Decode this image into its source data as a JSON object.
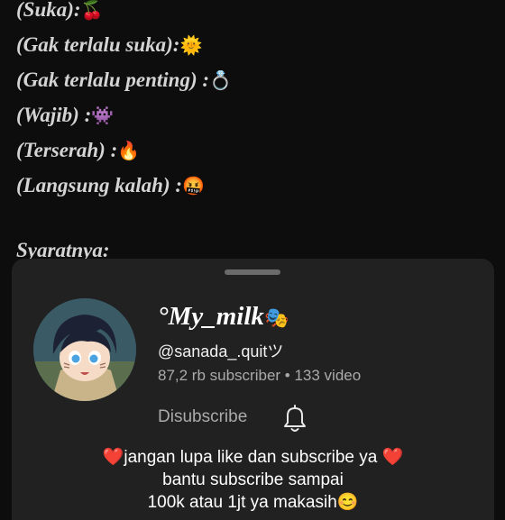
{
  "background": {
    "lines": [
      {
        "text": "(Suka):",
        "emoji": "🍒"
      },
      {
        "text": "(Gak terlalu suka):",
        "emoji": "🌞"
      },
      {
        "text": "(Gak terlalu penting) :",
        "emoji": "💍"
      },
      {
        "text": "(Wajib) :",
        "emoji": "👾"
      },
      {
        "text": "(Terserah) :",
        "emoji": "🔥"
      },
      {
        "text": "(Langsung kalah) :",
        "emoji": "🤬"
      }
    ],
    "footer": "Syaratnya:"
  },
  "channel": {
    "name": "°My_milk",
    "name_emoji": "🎭",
    "handle": "@sanada_.quitツ",
    "stats": "87,2 rb subscriber • 133 video",
    "unsubscribe_label": "Disubscribe",
    "description": [
      "❤️jangan lupa like dan subscribe ya ❤️",
      "bantu subscribe sampai",
      "100k atau 1jt ya makasih😊"
    ]
  },
  "colors": {
    "background": "#0d0d0d",
    "sheet": "#212121",
    "text_primary": "#ffffff",
    "text_secondary": "#aaaaaa"
  },
  "icons": {
    "bell": "bell-icon",
    "avatar": "anime-girl-avatar"
  }
}
